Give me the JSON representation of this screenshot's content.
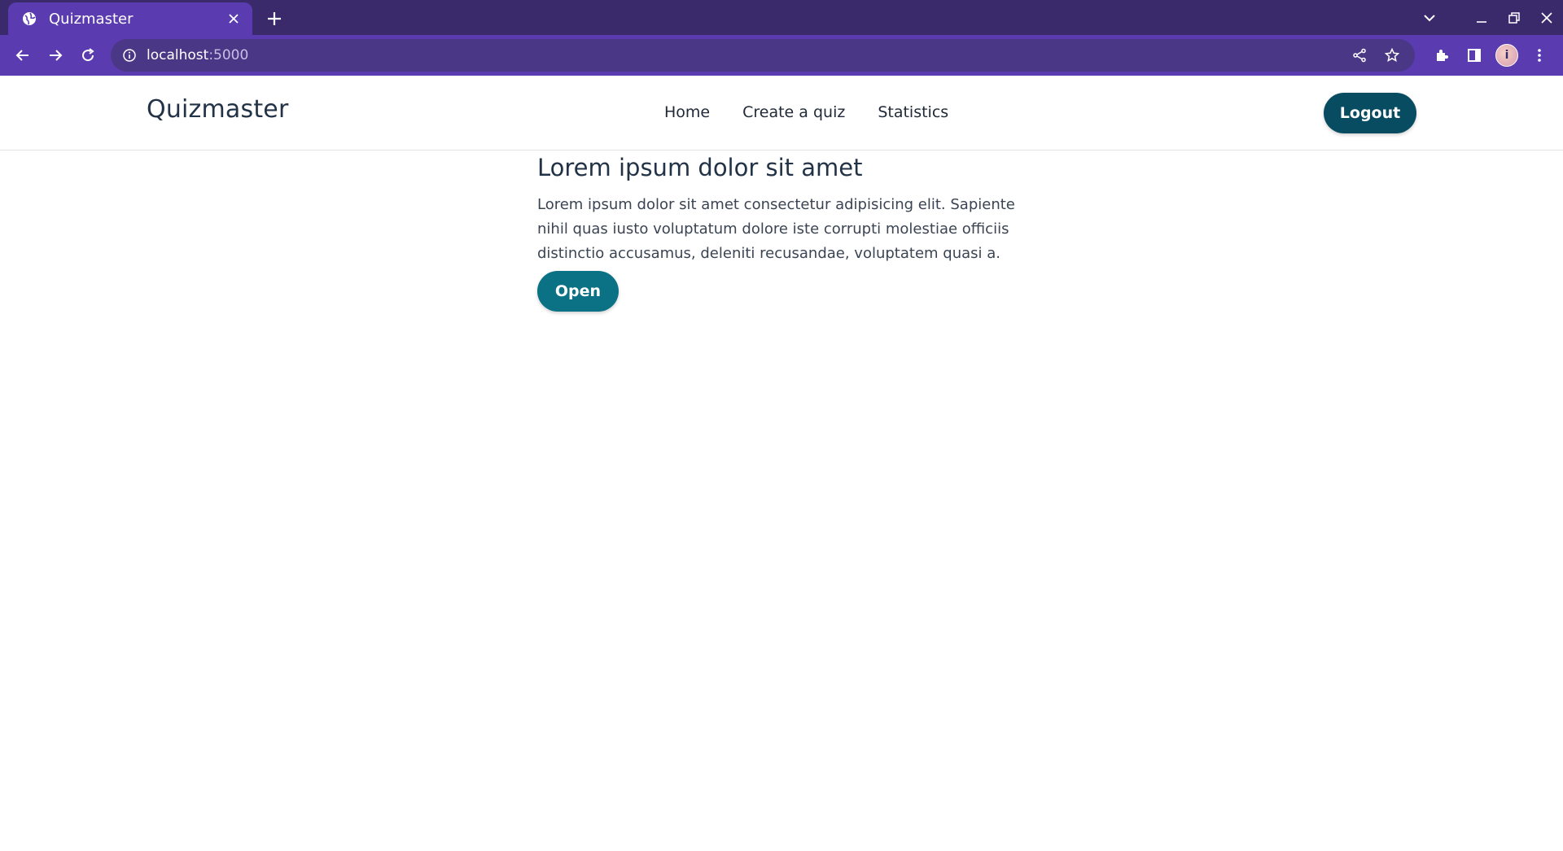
{
  "browser": {
    "tab": {
      "title": "Quizmaster",
      "favicon": "globe-icon"
    },
    "address": {
      "host": "localhost",
      "port": ":5000"
    },
    "colors": {
      "tabstrip": "#3b2a6b",
      "toolbar": "#5b3bb0",
      "omnibox": "#4a3785"
    }
  },
  "header": {
    "brand": "Quizmaster",
    "nav": [
      {
        "label": "Home"
      },
      {
        "label": "Create a quiz"
      },
      {
        "label": "Statistics"
      }
    ],
    "logout_label": "Logout"
  },
  "quiz": {
    "title": "Lorem ipsum dolor sit amet",
    "description": "Lorem ipsum dolor sit amet consectetur adipisicing elit. Sapiente nihil quas iusto voluptatum dolore iste corrupti molestiae officiis distinctio accusamus, deleniti recusandae, voluptatem quasi a.",
    "open_label": "Open"
  },
  "colors": {
    "primary": "#084c61",
    "accent": "#0b7285",
    "text": "#233347"
  }
}
